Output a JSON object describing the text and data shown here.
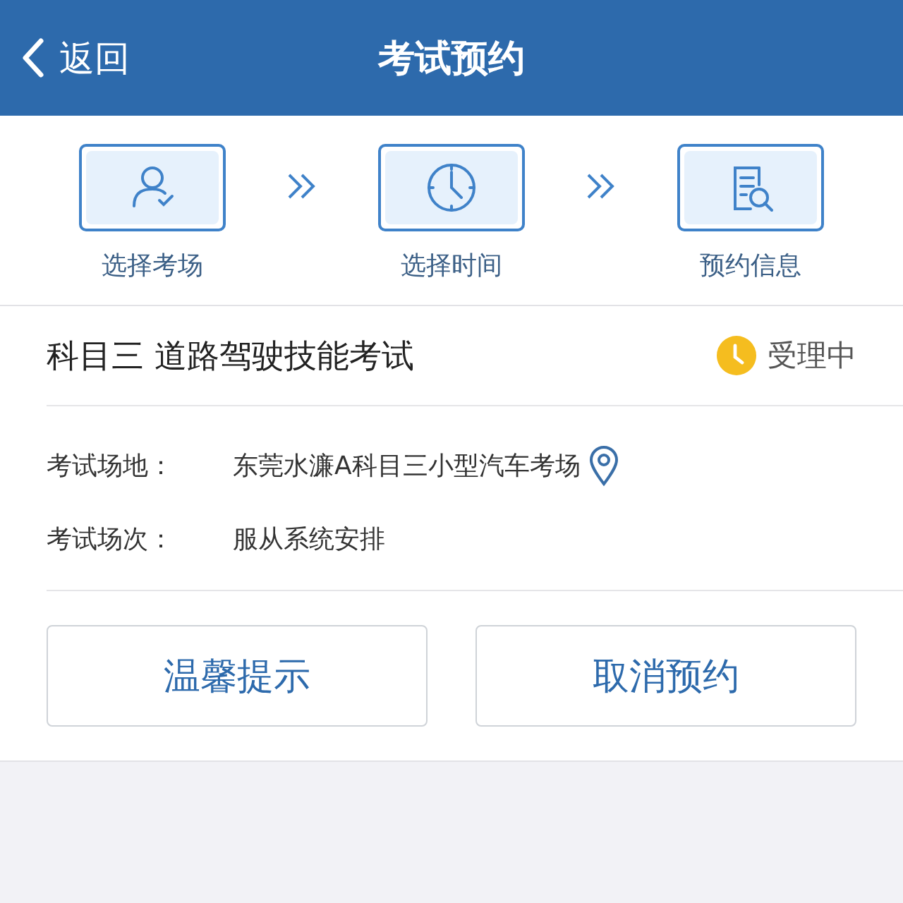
{
  "header": {
    "back": "返回",
    "title": "考试预约"
  },
  "steps": [
    {
      "label": "选择考场",
      "kind": "person"
    },
    {
      "label": "选择时间",
      "kind": "clock"
    },
    {
      "label": "预约信息",
      "kind": "document"
    }
  ],
  "exam": {
    "title": "科目三 道路驾驶技能考试",
    "status": "受理中",
    "fields": [
      {
        "label": "考试场地：",
        "value": "东莞水濂A科目三小型汽车考场",
        "kind": "location"
      },
      {
        "label": "考试场次：",
        "value": "服从系统安排",
        "kind": "text"
      }
    ]
  },
  "buttons": [
    "温馨提示",
    "取消预约"
  ]
}
